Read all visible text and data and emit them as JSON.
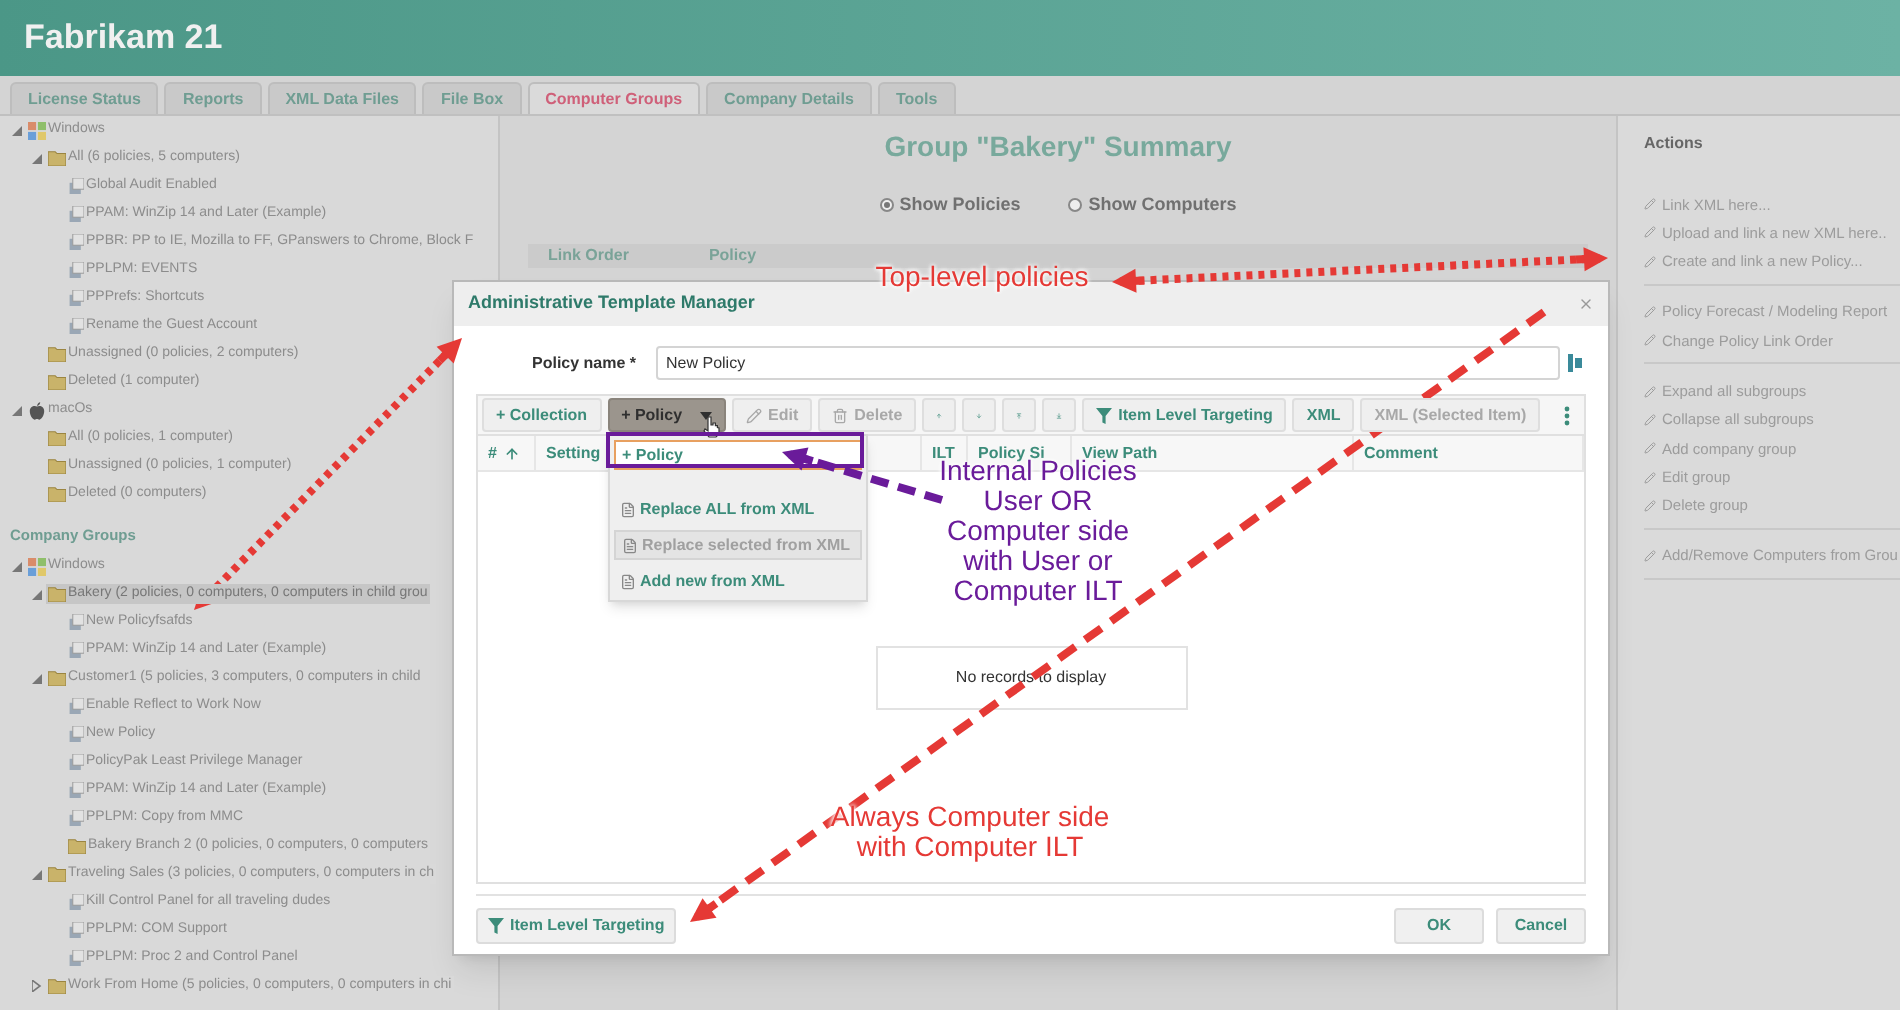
{
  "header": {
    "title": "Fabrikam 21"
  },
  "tabs": [
    {
      "label": "License Status",
      "selected": false
    },
    {
      "label": "Reports",
      "selected": false
    },
    {
      "label": "XML Data Files",
      "selected": false
    },
    {
      "label": "File Box",
      "selected": false
    },
    {
      "label": "Computer Groups",
      "selected": true
    },
    {
      "label": "Company Details",
      "selected": false
    },
    {
      "label": "Tools",
      "selected": false
    }
  ],
  "tree": [
    {
      "label": "Windows",
      "kind": "windows",
      "expanded": true,
      "selected": false,
      "children": [
        {
          "label": "All (6 policies, 5 computers)",
          "kind": "folder",
          "expanded": true,
          "selected": false,
          "children": [
            {
              "label": "Global Audit Enabled",
              "kind": "policy",
              "selected": false
            },
            {
              "label": "PPAM: WinZip 14 and Later (Example)",
              "kind": "policy",
              "selected": false
            },
            {
              "label": "PPBR: PP to IE, Mozilla to FF, GPanswers to Chrome, Block F",
              "kind": "policy",
              "selected": false
            },
            {
              "label": "PPLPM: EVENTS",
              "kind": "policy",
              "selected": false
            },
            {
              "label": "PPPrefs: Shortcuts",
              "kind": "policy",
              "selected": false
            },
            {
              "label": "Rename the Guest Account",
              "kind": "policy",
              "selected": false
            }
          ]
        },
        {
          "label": "Unassigned (0 policies, 2 computers)",
          "kind": "folder",
          "selected": false
        },
        {
          "label": "Deleted (1 computer)",
          "kind": "folder",
          "selected": false
        }
      ]
    },
    {
      "label": "macOs",
      "kind": "macos",
      "expanded": true,
      "selected": false,
      "children": [
        {
          "label": "All (0 policies, 1 computer)",
          "kind": "folder",
          "selected": false
        },
        {
          "label": "Unassigned (0 policies, 1 computer)",
          "kind": "folder",
          "selected": false
        },
        {
          "label": "Deleted (0 computers)",
          "kind": "folder",
          "selected": false
        }
      ]
    }
  ],
  "company_groups": {
    "heading": "Company Groups",
    "tree": [
      {
        "label": "Windows",
        "kind": "windows",
        "expanded": true,
        "selected": false,
        "children": [
          {
            "label": "Bakery (2 policies, 0 computers, 0 computers in child grou",
            "kind": "folder",
            "expanded": true,
            "selected": true,
            "children": [
              {
                "label": "New Policyfsafds",
                "kind": "policy",
                "selected": false
              },
              {
                "label": "PPAM: WinZip 14 and Later (Example)",
                "kind": "policy",
                "selected": false
              }
            ]
          },
          {
            "label": "Customer1 (5 policies, 3 computers, 0 computers in child",
            "kind": "folder",
            "expanded": true,
            "selected": false,
            "children": [
              {
                "label": "Enable Reflect to Work Now",
                "kind": "policy",
                "selected": false
              },
              {
                "label": "New Policy",
                "kind": "policy",
                "selected": false
              },
              {
                "label": "PolicyPak Least Privilege Manager",
                "kind": "policy",
                "selected": false
              },
              {
                "label": "PPAM: WinZip 14 and Later (Example)",
                "kind": "policy",
                "selected": false
              },
              {
                "label": "PPLPM: Copy from MMC",
                "kind": "policy",
                "selected": false
              },
              {
                "label": "Bakery Branch 2 (0 policies, 0 computers, 0 computers",
                "kind": "folder",
                "selected": false
              }
            ]
          },
          {
            "label": "Traveling Sales (3 policies, 0 computers, 0 computers in ch",
            "kind": "folder",
            "expanded": true,
            "selected": false,
            "children": [
              {
                "label": "Kill Control Panel for all traveling dudes",
                "kind": "policy",
                "selected": false
              },
              {
                "label": "PPLPM: COM Support",
                "kind": "policy",
                "selected": false
              },
              {
                "label": "PPLPM: Proc 2 and Control Panel",
                "kind": "policy",
                "selected": false
              }
            ]
          },
          {
            "label": "Work From Home (5 policies, 0 computers, 0 computers in chi",
            "kind": "folder",
            "expanded": false,
            "selected": false
          }
        ]
      }
    ]
  },
  "summary": {
    "title": "Group \"Bakery\" Summary",
    "options": [
      {
        "label": "Show Policies",
        "selected": true
      },
      {
        "label": "Show Computers",
        "selected": false
      }
    ],
    "columns": [
      "Link Order",
      "Policy"
    ]
  },
  "actions": {
    "title": "Actions",
    "groups": [
      [
        "Link XML here...",
        "Upload and link a new XML here..",
        "Create and link a new Policy..."
      ],
      [
        "Policy Forecast / Modeling Report",
        "Change Policy Link Order"
      ],
      [
        "Expand all subgroups",
        "Collapse all subgroups",
        "Add company group",
        "Edit group",
        "Delete group"
      ],
      [
        "Add/Remove Computers from Grou"
      ]
    ]
  },
  "dialog": {
    "title": "Administrative Template Manager",
    "policy_name": {
      "label": "Policy name *",
      "value": "New Policy"
    },
    "toolbar": [
      {
        "kind": "text",
        "label": "+ Collection",
        "disabled": false
      },
      {
        "kind": "dropdown",
        "label": "+ Policy",
        "disabled": false,
        "expanded": true
      },
      {
        "kind": "edit",
        "label": "Edit",
        "disabled": true
      },
      {
        "kind": "delete",
        "label": "Delete",
        "disabled": true
      },
      {
        "kind": "up",
        "disabled": false
      },
      {
        "kind": "down",
        "disabled": false
      },
      {
        "kind": "top",
        "disabled": false
      },
      {
        "kind": "bottom",
        "disabled": false
      },
      {
        "kind": "filter",
        "label": "Item Level Targeting",
        "disabled": false
      },
      {
        "kind": "text",
        "label": "XML",
        "disabled": false
      },
      {
        "kind": "text",
        "label": "XML (Selected Item)",
        "disabled": true
      },
      {
        "kind": "more",
        "disabled": false
      }
    ],
    "menu": [
      {
        "kind": "add",
        "label": "+ Policy",
        "disabled": false,
        "highlighted": true
      },
      {
        "kind": "xml",
        "label": "Replace ALL from XML",
        "disabled": false,
        "highlighted": false
      },
      {
        "kind": "xml",
        "label": "Replace selected from XML",
        "disabled": true,
        "highlighted": false
      },
      {
        "kind": "xml",
        "label": "Add new from XML",
        "disabled": false,
        "highlighted": false
      }
    ],
    "columns": [
      {
        "label": "#",
        "sorted": true
      },
      {
        "label": "Setting"
      },
      {
        "label": "ILT"
      },
      {
        "label": "Policy Si"
      },
      {
        "label": "View Path"
      },
      {
        "label": "Comment"
      }
    ],
    "empty_text": "No records to display",
    "footer": {
      "left": {
        "label": "Item Level Targeting"
      },
      "right": [
        "OK",
        "Cancel"
      ]
    }
  },
  "annotations": [
    {
      "lines": [
        "Top-level policies"
      ],
      "color": "#e53935"
    },
    {
      "lines": [
        "Internal Policies",
        "User OR",
        "Computer side",
        "with User or",
        "Computer ILT"
      ],
      "color": "#6a1b9a"
    },
    {
      "lines": [
        "Always Computer side",
        "with Computer ILT"
      ],
      "color": "#e53935"
    }
  ]
}
